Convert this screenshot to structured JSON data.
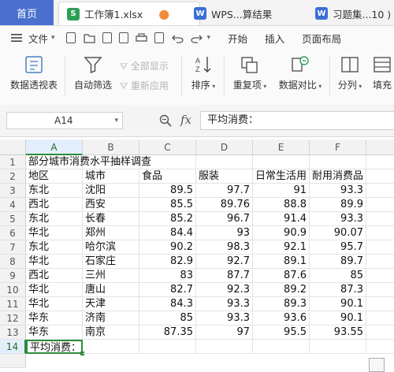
{
  "tabs": {
    "home": "首页",
    "items": [
      {
        "label": "工作簿1.xlsx",
        "badge": "S",
        "badge_color": "#2e9e58",
        "active": true
      },
      {
        "label": "WPS...算结果",
        "badge": "W",
        "badge_color": "#3b6fd6",
        "active": false
      },
      {
        "label": "习题集...10 )",
        "badge": "W",
        "badge_color": "#3b6fd6",
        "active": false
      }
    ]
  },
  "menu": {
    "file": "文件",
    "items": [
      "开始",
      "插入",
      "页面布局"
    ]
  },
  "ribbon": {
    "pivot": "数据透视表",
    "autofilter": "自动筛选",
    "show_all": "全部显示",
    "reapply": "重新应用",
    "sort": "排序",
    "dup": "重复项",
    "compare": "数据对比",
    "split": "分列",
    "fill": "填充"
  },
  "formula_bar": {
    "cell_ref": "A14",
    "fx": "fx",
    "content": "平均消费："
  },
  "sheet": {
    "columns": [
      "A",
      "B",
      "C",
      "D",
      "E",
      "F"
    ],
    "selected_col": "A",
    "selected_row": "14",
    "rows": [
      {
        "n": "1",
        "cells": [
          "部分城市消费水平抽样调查",
          "",
          "",
          "",
          "",
          ""
        ]
      },
      {
        "n": "2",
        "cells": [
          "地区",
          "城市",
          "食品",
          "服装",
          "日常生活用",
          "耐用消费品"
        ]
      },
      {
        "n": "3",
        "cells": [
          "东北",
          "沈阳",
          "89.5",
          "97.7",
          "91",
          "93.3"
        ]
      },
      {
        "n": "4",
        "cells": [
          "西北",
          "西安",
          "85.5",
          "89.76",
          "88.8",
          "89.9"
        ]
      },
      {
        "n": "5",
        "cells": [
          "东北",
          "长春",
          "85.2",
          "96.7",
          "91.4",
          "93.3"
        ]
      },
      {
        "n": "6",
        "cells": [
          "华北",
          "郑州",
          "84.4",
          "93",
          "90.9",
          "90.07"
        ]
      },
      {
        "n": "7",
        "cells": [
          "东北",
          "哈尔滨",
          "90.2",
          "98.3",
          "92.1",
          "95.7"
        ]
      },
      {
        "n": "8",
        "cells": [
          "华北",
          "石家庄",
          "82.9",
          "92.7",
          "89.1",
          "89.7"
        ]
      },
      {
        "n": "9",
        "cells": [
          "西北",
          "三州",
          "83",
          "87.7",
          "87.6",
          "85"
        ]
      },
      {
        "n": "10",
        "cells": [
          "华北",
          "唐山",
          "82.7",
          "92.3",
          "89.2",
          "87.3"
        ]
      },
      {
        "n": "11",
        "cells": [
          "华北",
          "天津",
          "84.3",
          "93.3",
          "89.3",
          "90.1"
        ]
      },
      {
        "n": "12",
        "cells": [
          "华东",
          "济南",
          "85",
          "93.3",
          "93.6",
          "90.1"
        ]
      },
      {
        "n": "13",
        "cells": [
          "华东",
          "南京",
          "87.35",
          "97",
          "95.5",
          "93.55"
        ]
      },
      {
        "n": "14",
        "cells": [
          "平均消费：",
          "",
          "",
          "",
          "",
          ""
        ]
      }
    ]
  }
}
